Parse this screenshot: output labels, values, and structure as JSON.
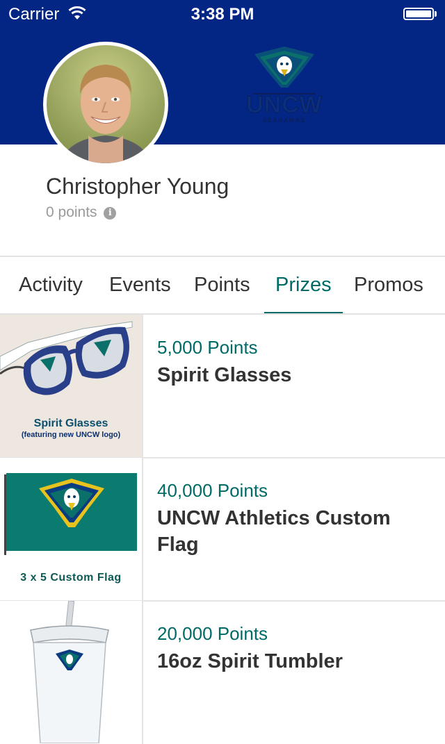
{
  "status_bar": {
    "carrier": "Carrier",
    "time": "3:38 PM",
    "wifi_icon": "wifi-icon",
    "battery_icon": "battery-icon"
  },
  "profile": {
    "name": "Christopher Young",
    "points": "0 points",
    "info_icon": "info-icon"
  },
  "tabs": [
    {
      "label": "Activity",
      "active": false
    },
    {
      "label": "Events",
      "active": false
    },
    {
      "label": "Points",
      "active": false
    },
    {
      "label": "Prizes",
      "active": true
    },
    {
      "label": "Promos",
      "active": false
    }
  ],
  "prizes": [
    {
      "points": "5,000 Points",
      "title": "Spirit Glasses",
      "image_caption_1": "Spirit Glasses",
      "image_caption_2": "(featuring new UNCW logo)"
    },
    {
      "points": "40,000 Points",
      "title": "UNCW Athletics Custom Flag",
      "image_caption_1": "3 x 5 Custom Flag"
    },
    {
      "points": "20,000 Points",
      "title": "16oz Spirit Tumbler"
    }
  ],
  "colors": {
    "header_bg": "#032584",
    "accent": "#006b66",
    "separator": "#e2e2e2",
    "text": "#333333",
    "muted": "#9a9a9a"
  }
}
